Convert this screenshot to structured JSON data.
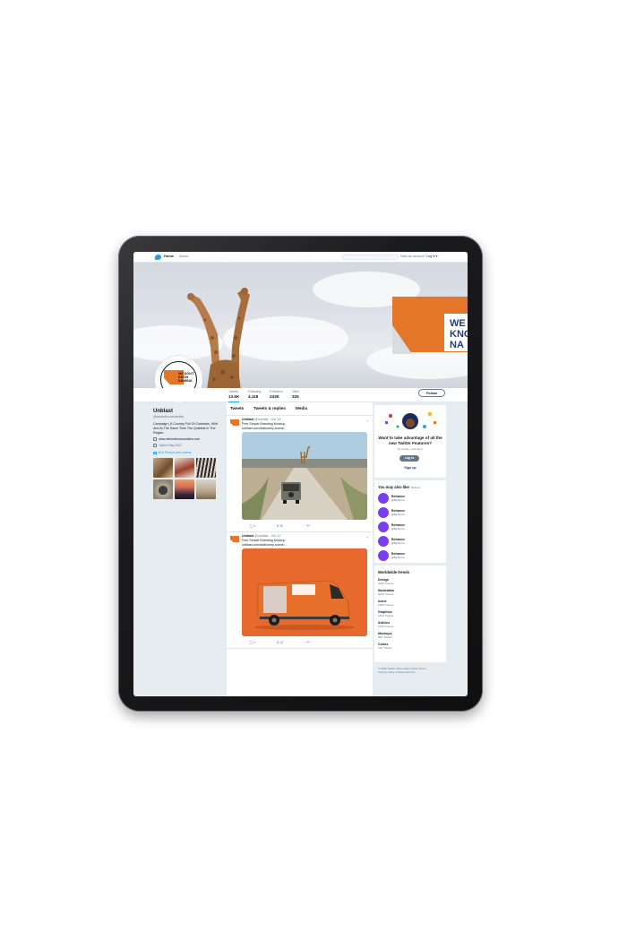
{
  "nav": {
    "home": "Home",
    "about": "About",
    "account_prefix": "Have an account?",
    "login": "Log in ▾"
  },
  "header": {
    "banner_text": [
      "WE",
      "KNO",
      "NA"
    ],
    "logo_text": [
      "WE DON'T",
      "KNOW",
      "NAMIBIA"
    ]
  },
  "stats": [
    {
      "label": "Tweets",
      "value": "13.6K"
    },
    {
      "label": "Following",
      "value": "4,118"
    },
    {
      "label": "Followers",
      "value": "243K"
    },
    {
      "label": "Likes",
      "value": "325"
    }
  ],
  "follow_button": "Follow",
  "profile": {
    "name": "Unblast",
    "handle": "@wedontknownamibia",
    "bio": "Campaign | A Country Full Of Contrasts, Wild And At The Same Time The Quietest In The Region.",
    "website": "www.wedontknownamibia.com",
    "joined": "Joined May 2021",
    "photos_label": "824 Photos and videos"
  },
  "tabs": [
    "Tweets",
    "Tweets & replies",
    "Media"
  ],
  "tweets": [
    {
      "author": "Unblast",
      "handle": "@unblast · Oct 14",
      "text": [
        "Free Simple Branding Mockup",
        "unblast.com/stationery-scene..."
      ],
      "actions": [
        "4",
        "50",
        "97"
      ]
    },
    {
      "author": "Unblast",
      "handle": "@unblast · Oct 12",
      "text": [
        "Free Simple Branding Mockup",
        "unblast.com/stationery-scene..."
      ],
      "actions": [
        "4",
        "12",
        "97"
      ]
    }
  ],
  "promo": {
    "title": "Want to take advantage of all the new Twitter Features?",
    "subtitle": "It's simple - just log in",
    "login": "Log in",
    "signup": "Sign up"
  },
  "you_may_like": {
    "title": "You may also like",
    "refresh": "Refresh",
    "items": [
      {
        "name": "Behance",
        "handle": "@Behance"
      },
      {
        "name": "Behance",
        "handle": "@Behance"
      },
      {
        "name": "Behance",
        "handle": "@Behance"
      },
      {
        "name": "Behance",
        "handle": "@Behance"
      },
      {
        "name": "Behance",
        "handle": "@Behance"
      }
    ]
  },
  "trends": {
    "title": "Worldwide trends",
    "items": [
      {
        "name": "Design",
        "count": "491K Tweets"
      },
      {
        "name": "Illustration",
        "count": "300K Tweets"
      },
      {
        "name": "Icons",
        "count": "160K Tweets"
      },
      {
        "name": "Graphics",
        "count": "145K Tweets"
      },
      {
        "name": "Articles",
        "count": "163K Tweets"
      },
      {
        "name": "Mockups",
        "count": "90K Tweets"
      },
      {
        "name": "Colors",
        "count": "74K Tweets"
      }
    ]
  },
  "footer": {
    "line1": "© 2019 Twitter  About  Help Center  Terms",
    "line2": "Privacy policy  Cookies  Ads info"
  },
  "colors": {
    "brand_orange": "#e4762a",
    "twitter_blue": "#1da1f2",
    "behance_purple": "#7b3ff2"
  }
}
